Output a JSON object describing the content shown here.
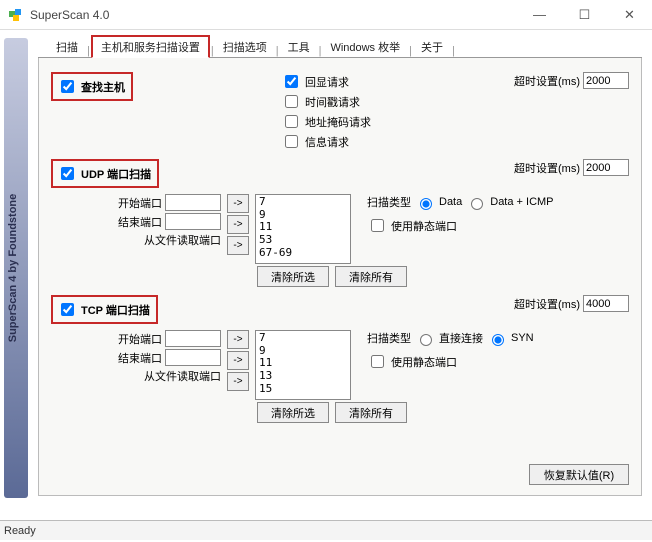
{
  "window": {
    "title": "SuperScan 4.0"
  },
  "tabs": {
    "scan": "扫描",
    "host_port_settings": "主机和服务扫描设置",
    "scan_options": "扫描选项",
    "tools": "工具",
    "win_enum": "Windows 枚举",
    "about": "关于"
  },
  "host": {
    "find_hosts": "查找主机",
    "echo_request": "回显请求",
    "timestamp_request": "时间戳请求",
    "addressmask_request": "地址掩码请求",
    "info_request": "信息请求",
    "timeout_label": "超时设置(ms)",
    "timeout_value": "2000"
  },
  "udp": {
    "title": "UDP 端口扫描",
    "start_port": "开始端口",
    "end_port": "结束端口",
    "from_file": "从文件读取端口",
    "ports_list": "7\n9\n11\n53\n67-69",
    "clear_selected": "清除所选",
    "clear_all": "清除所有",
    "timeout_label": "超时设置(ms)",
    "timeout_value": "2000",
    "scan_type_label": "扫描类型",
    "scan_type_data": "Data",
    "scan_type_dataicmp": "Data + ICMP",
    "use_static_port": "使用静态端口"
  },
  "tcp": {
    "title": "TCP 端口扫描",
    "start_port": "开始端口",
    "end_port": "结束端口",
    "from_file": "从文件读取端口",
    "ports_list": "7\n9\n11\n13\n15",
    "clear_selected": "清除所选",
    "clear_all": "清除所有",
    "timeout_label": "超时设置(ms)",
    "timeout_value": "4000",
    "scan_type_label": "扫描类型",
    "scan_type_direct": "直接连接",
    "scan_type_syn": "SYN",
    "use_static_port": "使用静态端口"
  },
  "restore_defaults": "恢复默认值(R)",
  "status": "Ready",
  "arrow": "->",
  "sidebar_text": "SuperScan 4 by Foundstone"
}
